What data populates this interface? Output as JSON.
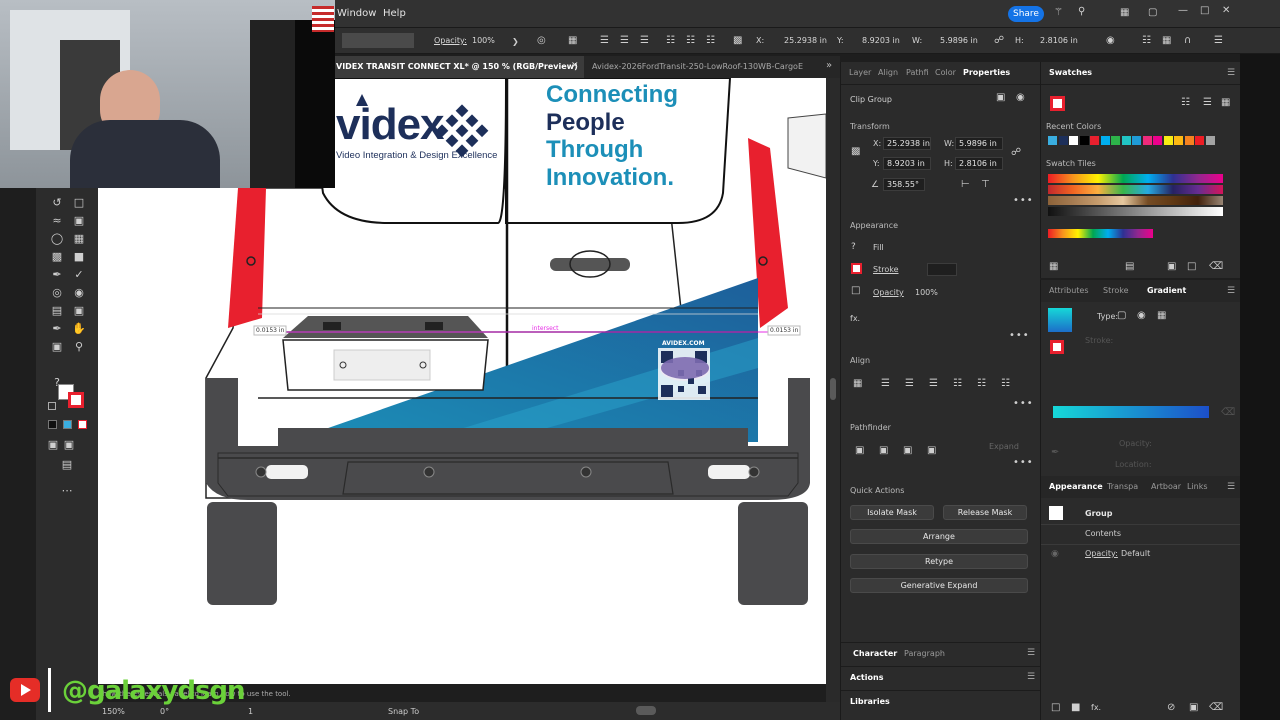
{
  "menu": {
    "window": "Window",
    "help": "Help"
  },
  "topright": {
    "share": "Share"
  },
  "control": {
    "opacity_label": "Opacity:",
    "opacity_value": "100%",
    "x_label": "X:",
    "x_value": "25.2938 in",
    "y_label": "Y:",
    "y_value": "8.9203 in",
    "w_label": "W:",
    "w_value": "5.9896 in",
    "h_label": "H:",
    "h_value": "2.8106 in"
  },
  "tabs": [
    {
      "label": "VIDEX TRANSIT CONNECT XL* @ 150 % (RGB/Preview)",
      "close": "✕"
    },
    {
      "label": "Avidex-2026FordTransit-250-LowRoof-130WB-CargoE"
    }
  ],
  "artwork": {
    "logo_text": "videx",
    "logo_tagline": "Video Integration & Design Excellence",
    "headline": [
      "Connecting",
      "People",
      "Through",
      "Innovation."
    ],
    "qr_caption": "AVIDEX.COM",
    "measure_left": "0.0153 in",
    "measure_right": "0.0153 in",
    "intersect": "intersect",
    "colors": {
      "navy": "#1d2f5a",
      "teal": "#1c8fb8",
      "red": "#e8202e",
      "gray": "#4a4a4c"
    }
  },
  "properties_panel": {
    "tabs": [
      "Layer",
      "Align",
      "Pathfi",
      "Color",
      "Properties"
    ],
    "object": "Clip Group",
    "transform_label": "Transform",
    "x_label": "X:",
    "x": "25.2938 in",
    "y_label": "Y:",
    "y": "8.9203 in",
    "w_label": "W:",
    "w": "5.9896 in",
    "h_label": "H:",
    "h": "2.8106 in",
    "angle": "358.55°",
    "appearance_label": "Appearance",
    "fill": "Fill",
    "stroke": "Stroke",
    "opacity": "Opacity",
    "opacity_value": "100%",
    "fx": "fx.",
    "align_label": "Align",
    "pathfinder_label": "Pathfinder",
    "expand": "Expand",
    "quick_actions_label": "Quick Actions",
    "isolate_mask": "Isolate Mask",
    "release_mask": "Release Mask",
    "arrange": "Arrange",
    "retype": "Retype",
    "generative_expand": "Generative Expand",
    "character": "Character",
    "paragraph": "Paragraph",
    "actions": "Actions",
    "libraries": "Libraries"
  },
  "swatches_panel": {
    "title": "Swatches",
    "recent_colors": "Recent Colors",
    "swatch_tiles": "Swatch Tiles",
    "recent": [
      "#3aaee0",
      "#1d2f5a",
      "#ffffff",
      "#000000",
      "#e8202e",
      "#00aeef",
      "#2db34a",
      "#21c4c4",
      "#1f9bd7",
      "#ee2a7b",
      "#ec008c",
      "#f7ec13",
      "#fdb913",
      "#f58220",
      "#ed1c24",
      "#a3a3a3"
    ]
  },
  "gradient_panel": {
    "tabs": [
      "Attributes",
      "Stroke",
      "Gradient"
    ],
    "type": "Type:",
    "stroke": "Stroke:",
    "opacity": "Opacity:",
    "location": "Location:"
  },
  "appearance_panel": {
    "tabs": [
      "Appearance",
      "Transpa",
      "Artboar",
      "Links"
    ],
    "group": "Group",
    "contents": "Contents",
    "opacity": "Opacity:",
    "opacity_value": "Default"
  },
  "status": {
    "zoom": "150%",
    "angle": "0°",
    "artboard": "1",
    "snap": "Snap To",
    "hint": "Show the Essentials panel to learn how to use the tool."
  },
  "overlay": {
    "handle": "@galaxydsgn"
  }
}
